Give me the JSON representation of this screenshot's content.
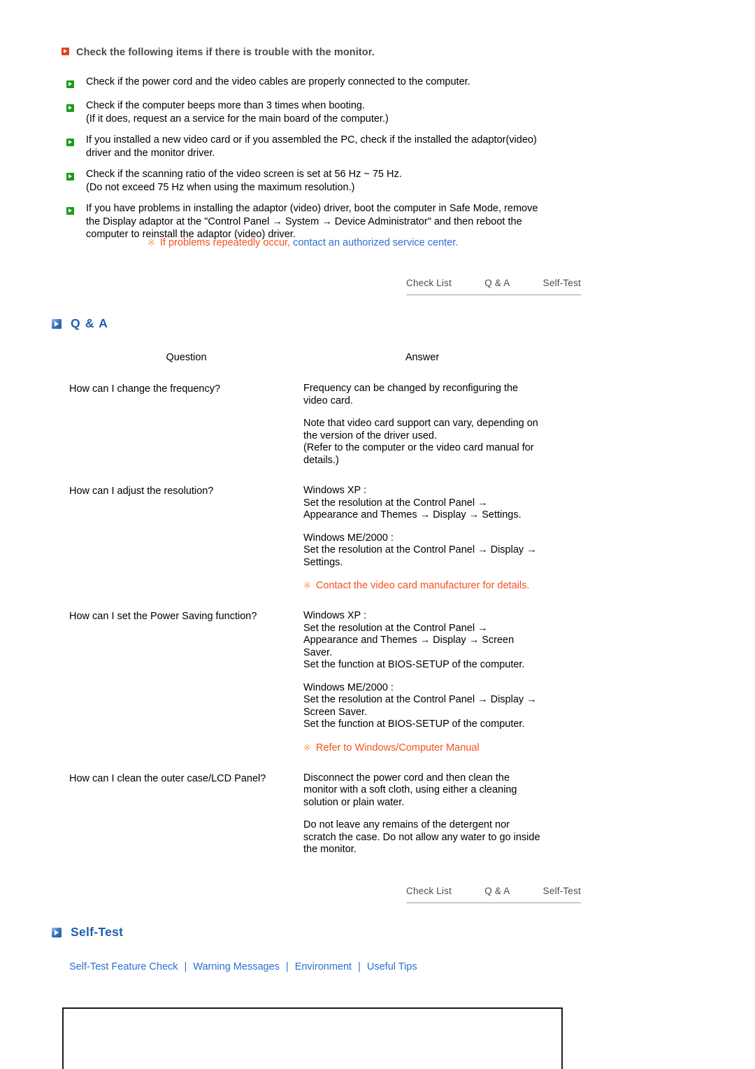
{
  "checklist": {
    "header": {
      "icon": "orange-arrow-icon",
      "text": "Check the following items if there is trouble with the monitor."
    },
    "items": [
      {
        "lines": [
          "Check if the power cord and the video cables are properly connected to the computer."
        ]
      },
      {
        "lines": [
          "Check if the computer beeps more than 3 times when booting.",
          "(If it does, request an a service for the main board of the computer.)"
        ]
      },
      {
        "lines": [
          "If you installed a new video card or if you assembled the PC, check if the installed the adaptor(video)",
          "driver and the monitor driver."
        ]
      },
      {
        "lines": [
          "Check if the scanning ratio of the video screen is set at 56 Hz ~ 75 Hz.",
          "(Do not exceed 75 Hz when using the maximum resolution.)"
        ]
      },
      {
        "lines": [
          "If you have problems in installing the adaptor (video) driver, boot the computer in Safe Mode, remove",
          "the Display adaptor at the \"Control Panel → System → Device Administrator\" and then reboot the",
          "computer to reinstall the adaptor (video) driver."
        ]
      }
    ],
    "notice": {
      "star": "※",
      "red_part": "If problems repeatedly occur,",
      "blue_part": " contact an authorized service center."
    }
  },
  "tabs_top": {
    "items": [
      {
        "label": "Check List"
      },
      {
        "label": "Q & A"
      },
      {
        "label": "Self-Test"
      }
    ]
  },
  "tabs_bottom": {
    "items": [
      {
        "label": "Check List"
      },
      {
        "label": "Q & A"
      },
      {
        "label": "Self-Test"
      }
    ]
  },
  "qa_section": {
    "icon": "blue-arrow-icon",
    "title": "Q & A",
    "col_question": "Question",
    "col_answer": "Answer",
    "rows": [
      {
        "question": "How can I change the frequency?",
        "blocks": [
          {
            "type": "text",
            "lines": [
              "Frequency can be changed by reconfiguring the",
              "video card."
            ]
          },
          {
            "type": "text",
            "lines": [
              "Note that video card support can vary, depending on",
              "the version of the driver used.",
              "(Refer to the computer or the video card manual for",
              "details.)"
            ]
          }
        ]
      },
      {
        "question": "How can I adjust the resolution?",
        "blocks": [
          {
            "type": "text",
            "lines": [
              "Windows XP :",
              "Set the resolution at the Control Panel →",
              "Appearance and Themes → Display → Settings."
            ]
          },
          {
            "type": "text",
            "lines": [
              "Windows ME/2000 :",
              "Set the resolution at the Control Panel → Display →",
              "Settings."
            ]
          },
          {
            "type": "notice",
            "star": "※",
            "text": "Contact the video card manufacturer for details."
          }
        ]
      },
      {
        "question": "How can I set the Power Saving function?",
        "blocks": [
          {
            "type": "text",
            "lines": [
              "Windows XP :",
              "Set the resolution at the Control Panel →",
              "Appearance and Themes → Display → Screen",
              "Saver.",
              "Set the function at BIOS-SETUP of the computer."
            ]
          },
          {
            "type": "text",
            "lines": [
              "Windows ME/2000 :",
              "Set the resolution at the Control Panel → Display →",
              "Screen Saver.",
              "Set the function at BIOS-SETUP of the computer."
            ]
          },
          {
            "type": "notice",
            "star": "※",
            "text": "Refer to Windows/Computer Manual"
          }
        ]
      },
      {
        "question": "How can I clean the outer case/LCD Panel?",
        "blocks": [
          {
            "type": "text",
            "lines": [
              "Disconnect the power cord and then clean the",
              "monitor with a soft cloth, using either a cleaning",
              "solution or plain water."
            ]
          },
          {
            "type": "text",
            "lines": [
              "Do not leave any remains of the detergent nor",
              "scratch the case. Do not allow any water to go inside",
              "the monitor."
            ]
          }
        ]
      }
    ]
  },
  "selftest_section": {
    "icon": "blue-arrow-icon",
    "title": "Self-Test",
    "links": [
      {
        "label": "Self-Test Feature Check"
      },
      {
        "label": "Warning Messages"
      },
      {
        "label": "Environment"
      },
      {
        "label": "Useful Tips"
      }
    ],
    "separator": "|"
  },
  "colors": {
    "heading_blue": "#1d5fb0",
    "link_blue": "#2f6fd0",
    "notice_red": "#f4511e",
    "notice_star": "#f6a24a",
    "bullet_green": "#1a9b1a",
    "bullet_orange": "#e24016",
    "tab_gray": "#4a4a4a"
  }
}
